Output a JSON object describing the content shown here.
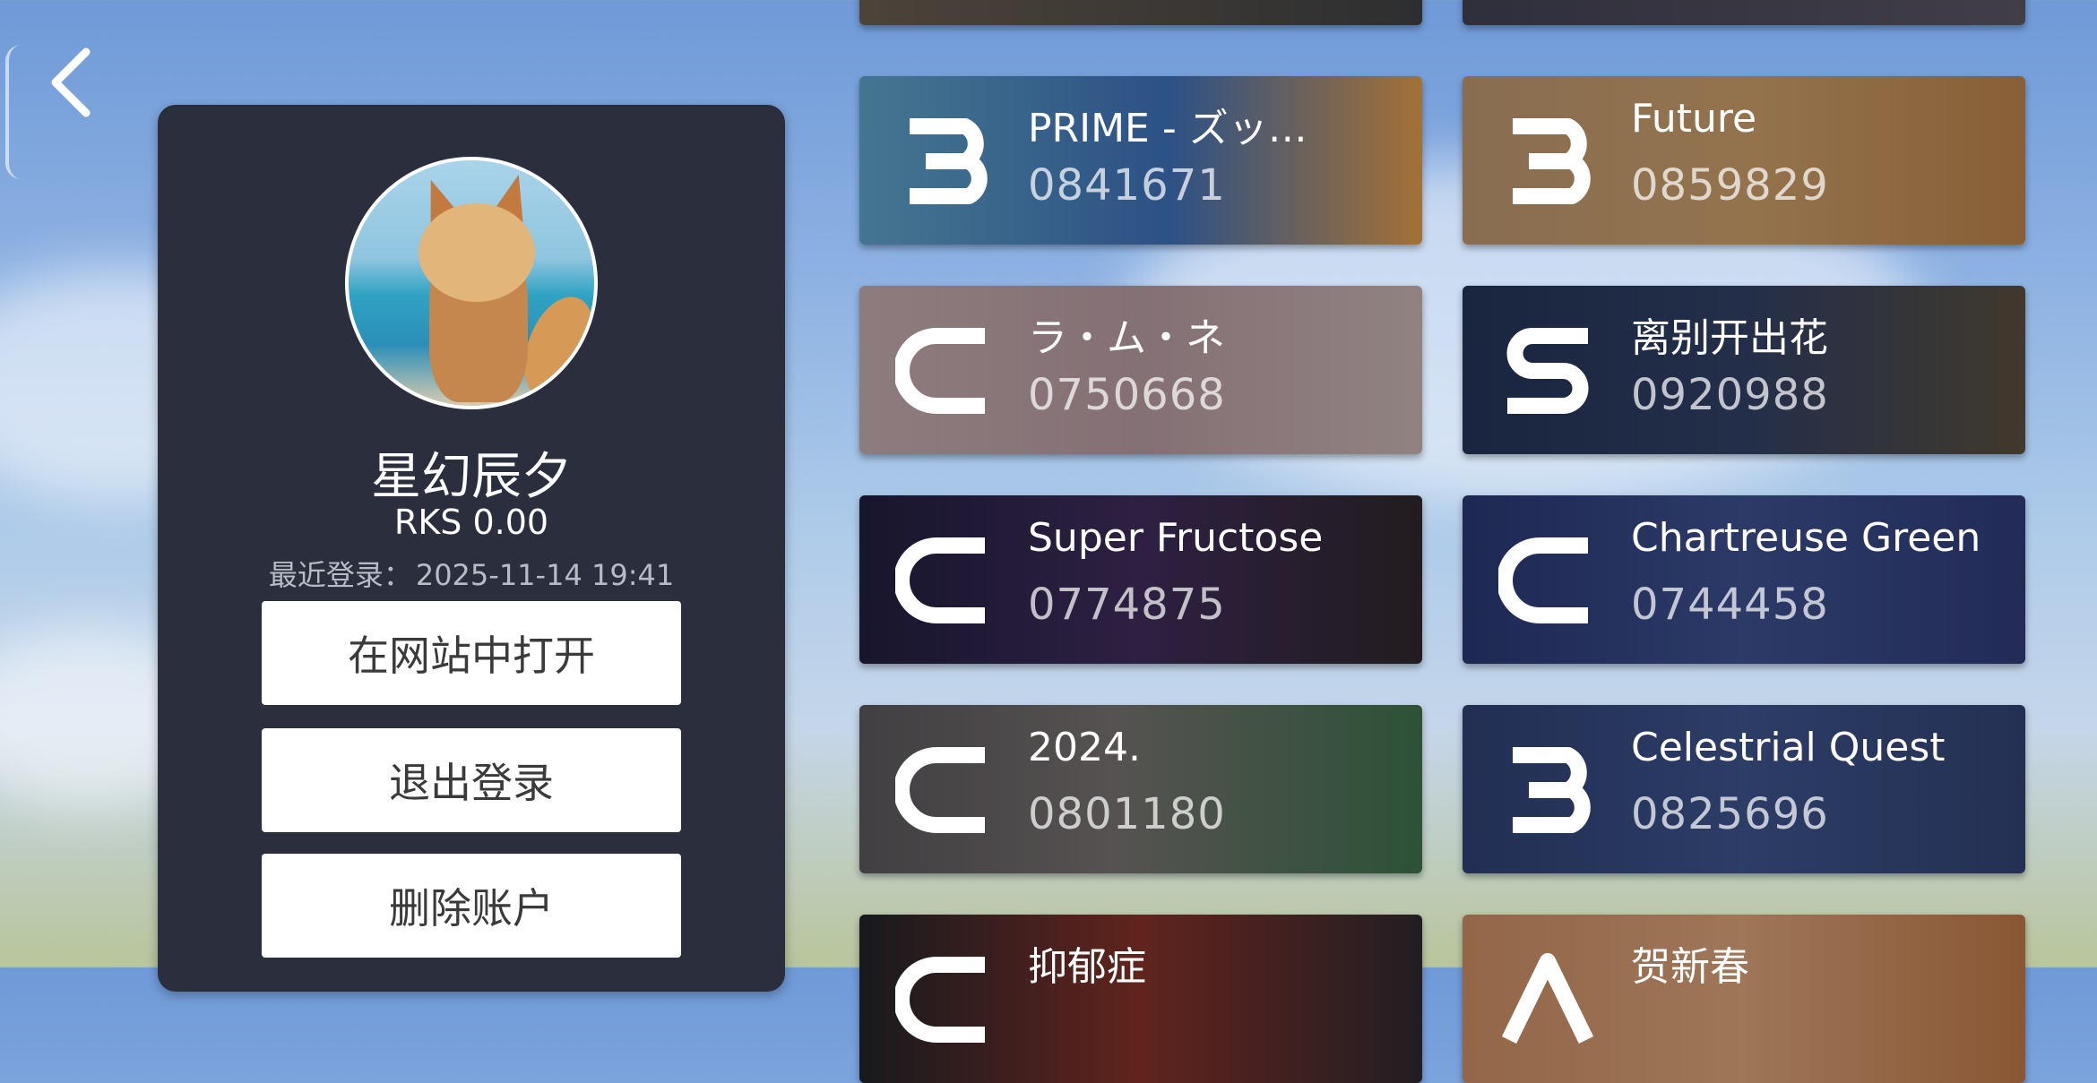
{
  "nav": {
    "back_icon": "chevron-left-icon"
  },
  "profile": {
    "avatar_icon": "fox-avatar",
    "username": "星幻辰夕",
    "rks": "RKS 0.00",
    "last_login_label": "最近登录：",
    "last_login_value": "2025-11-14 19:41",
    "buttons": {
      "open_website": "在网站中打开",
      "logout": "退出登录",
      "delete_account": "删除账户"
    }
  },
  "records": [
    {
      "grade": "B",
      "title": "PRIME - ズッ…",
      "score": "0841671"
    },
    {
      "grade": "B",
      "title": "Future",
      "score": "0859829"
    },
    {
      "grade": "C",
      "title": "ラ・ム・ネ",
      "score": "0750668"
    },
    {
      "grade": "S",
      "title": "离别开出花",
      "score": "0920988"
    },
    {
      "grade": "C",
      "title": "Super Fructose",
      "score": "0774875"
    },
    {
      "grade": "C",
      "title": "Chartreuse Green",
      "score": "0744458"
    },
    {
      "grade": "C",
      "title": "2024.",
      "score": "0801180"
    },
    {
      "grade": "B",
      "title": "Celestrial Quest",
      "score": "0825696"
    },
    {
      "grade": "C",
      "title": "抑郁症",
      "score": ""
    },
    {
      "grade": "A",
      "title": "贺新春",
      "score": ""
    }
  ],
  "colors": {
    "panel": "#2b2f3d",
    "button_bg": "#ffffff",
    "text_primary": "#ffffff",
    "text_muted": "#b8bcc6"
  }
}
